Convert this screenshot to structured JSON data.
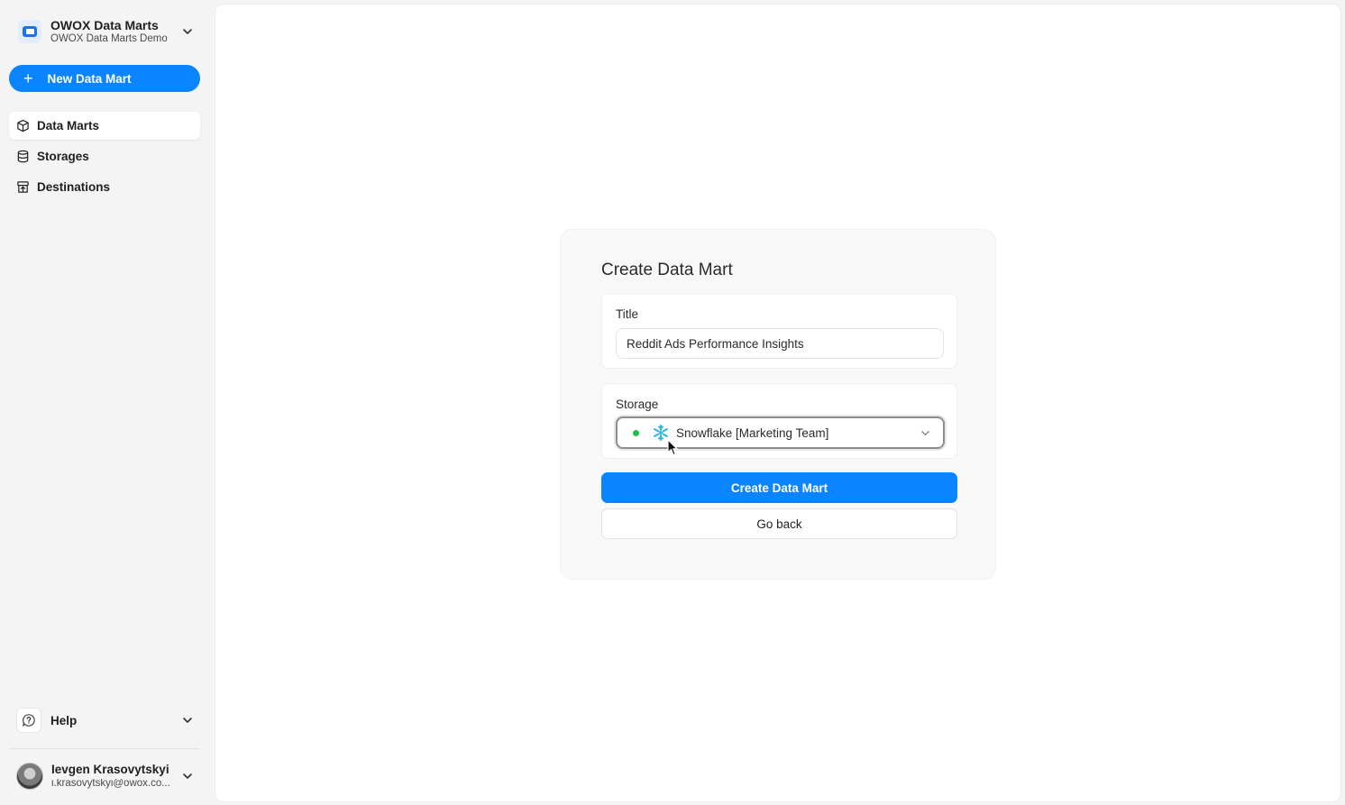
{
  "sidebar": {
    "org": {
      "name": "OWOX Data Marts",
      "subtitle": "OWOX Data Marts Demo",
      "logo_icon": "owox-logo-icon"
    },
    "new_button": {
      "label": "New Data Mart",
      "icon": "plus-icon"
    },
    "nav": [
      {
        "label": "Data Marts",
        "icon": "cube-icon",
        "active": true
      },
      {
        "label": "Storages",
        "icon": "database-icon",
        "active": false
      },
      {
        "label": "Destinations",
        "icon": "destination-icon",
        "active": false
      }
    ],
    "help": {
      "label": "Help",
      "icon": "help-chat-icon"
    },
    "user": {
      "name": "Ievgen Krasovytskyi",
      "email": "i.krasovytskyi@owox.co..."
    }
  },
  "form": {
    "heading": "Create Data Mart",
    "title_field": {
      "label": "Title",
      "value": "Reddit Ads Performance Insights"
    },
    "storage_field": {
      "label": "Storage",
      "selected": "Snowflake [Marketing Team]",
      "status_color": "#1fbf4b",
      "icon": "snowflake-icon"
    },
    "create_button": "Create Data Mart",
    "back_button": "Go back"
  },
  "colors": {
    "accent": "#0a84ff",
    "status_ok": "#1fbf4b"
  }
}
